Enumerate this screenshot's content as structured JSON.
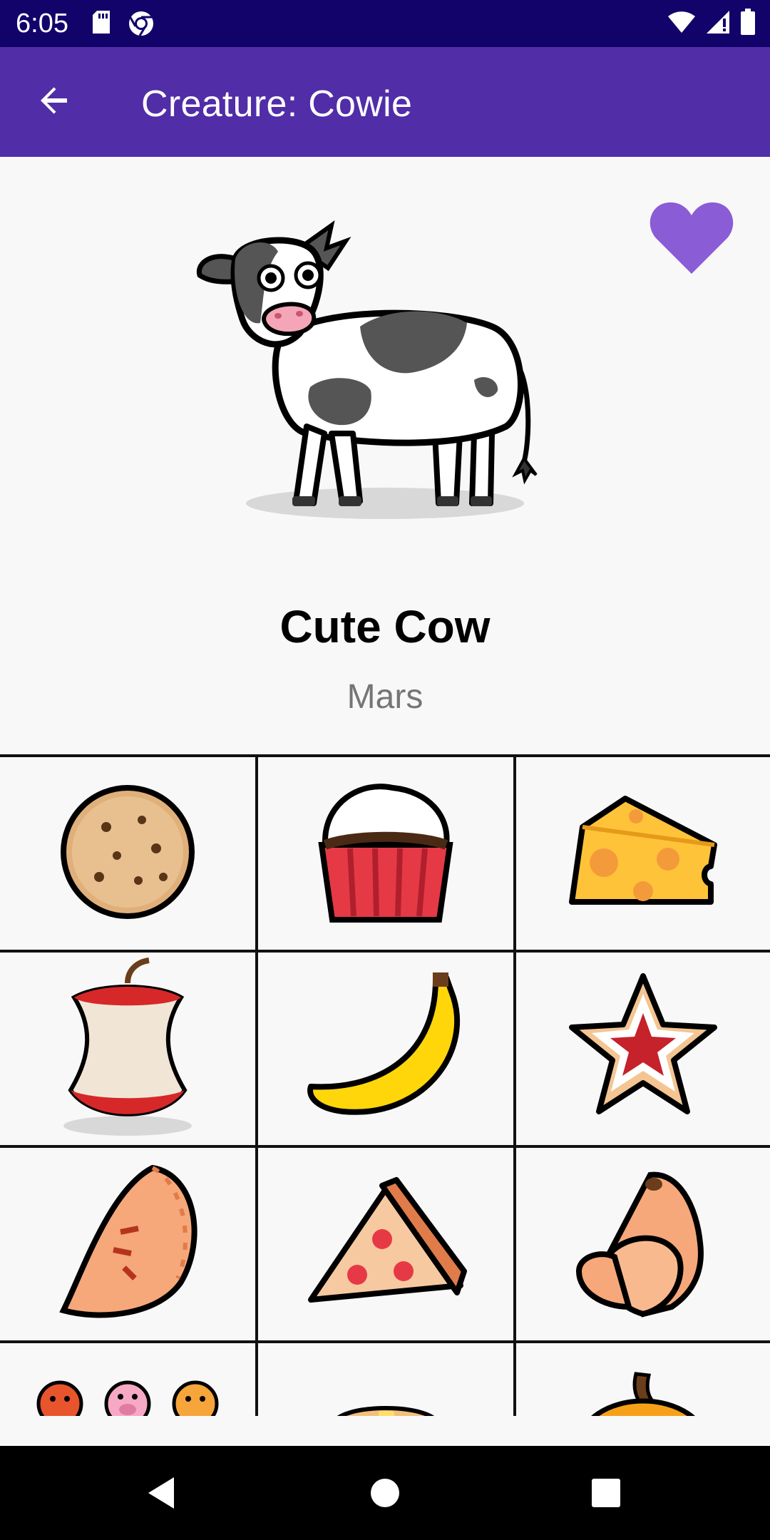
{
  "status_bar": {
    "time": "6:05",
    "left_icons": [
      "sd-card-icon",
      "chrome-icon"
    ],
    "right_icons": [
      "wifi-icon",
      "signal-icon",
      "battery-icon"
    ]
  },
  "app_bar": {
    "title": "Creature: Cowie",
    "back_icon": "arrow-back-icon",
    "background": "#512da8"
  },
  "creature": {
    "image": "cute-cow-image",
    "name": "Cute Cow",
    "planet": "Mars",
    "favorite": true,
    "favorite_color": "#8a5cd6"
  },
  "foods": [
    {
      "image": "cookie"
    },
    {
      "image": "cupcake"
    },
    {
      "image": "cheese"
    },
    {
      "image": "apple-core"
    },
    {
      "image": "banana"
    },
    {
      "image": "star-cookie"
    },
    {
      "image": "empanada"
    },
    {
      "image": "pizza-slice"
    },
    {
      "image": "croissant"
    },
    {
      "image": "animal-faces"
    },
    {
      "image": "pancakes"
    },
    {
      "image": "pumpkin"
    }
  ],
  "nav_bar": {
    "back_icon": "nav-back-icon",
    "home_icon": "nav-home-icon",
    "recents_icon": "nav-recents-icon"
  }
}
